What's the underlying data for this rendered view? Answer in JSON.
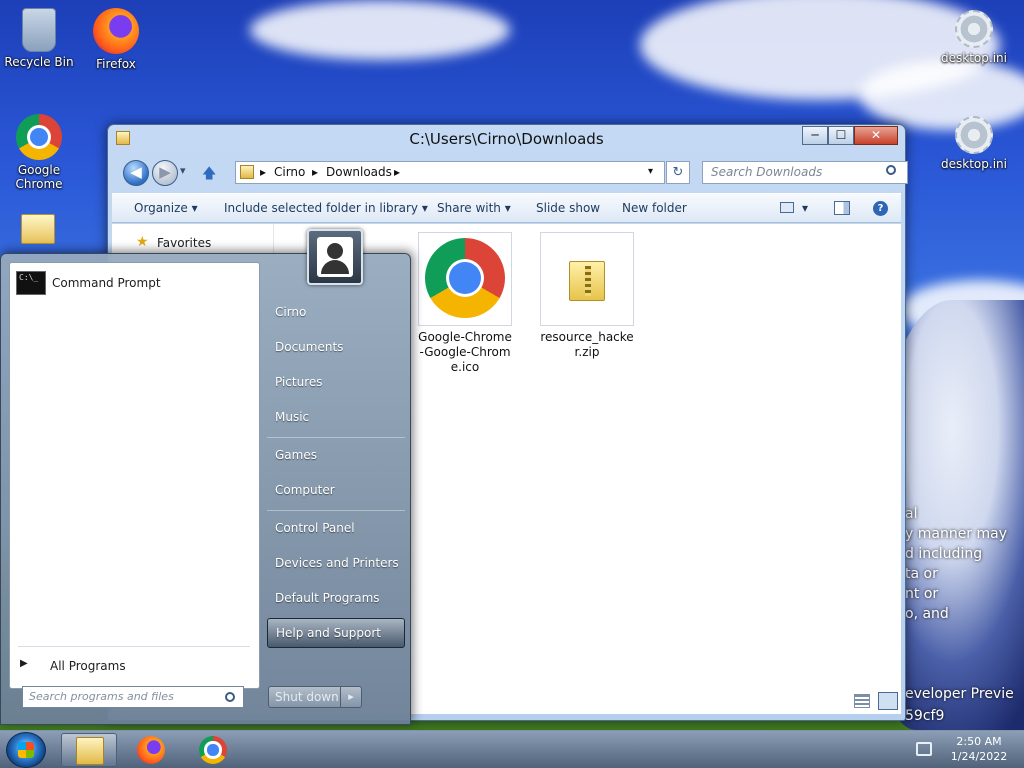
{
  "desktop": {
    "icons": [
      {
        "label": "Recycle Bin",
        "icon": "recycle-bin-icon"
      },
      {
        "label": "Firefox",
        "icon": "firefox-icon"
      },
      {
        "label": "Google Chrome",
        "icon": "chrome-icon"
      },
      {
        "label": "desktop.ini",
        "icon": "settings-file-icon"
      },
      {
        "label": "desktop.ini",
        "icon": "settings-file-icon"
      }
    ],
    "wallpaper_text": [
      "al",
      "y manner may",
      "d including",
      "ta or",
      "nt or",
      "o, and",
      "eveloper Previe",
      "59cf9"
    ]
  },
  "explorer": {
    "title": "C:\\Users\\Cirno\\Downloads",
    "window_controls": {
      "minimize": "─",
      "maximize": "☐",
      "close": "✕"
    },
    "nav": {
      "back": "◀",
      "forward": "▶",
      "recent": "▾",
      "up": "🡅",
      "refresh": "↻",
      "dropdown": "▾"
    },
    "address": {
      "crumbs": [
        "Cirno",
        "Downloads"
      ],
      "separator": "▸"
    },
    "search_placeholder": "Search Downloads",
    "commands": [
      {
        "label": "Organize",
        "arrow": "▾"
      },
      {
        "label": "Include selected folder in library",
        "arrow": "▾"
      },
      {
        "label": "Share with",
        "arrow": "▾"
      },
      {
        "label": "Slide show",
        "arrow": ""
      },
      {
        "label": "New folder",
        "arrow": ""
      }
    ],
    "navpane": {
      "favorites": "Favorites"
    },
    "files": [
      {
        "name": "Google-Chrome-Google-Chrome.ico",
        "icon": "chrome-icon"
      },
      {
        "name": "resource_hacker.zip",
        "icon": "zip-folder-icon"
      }
    ]
  },
  "start_menu": {
    "pinned": [
      {
        "label": "Command Prompt",
        "icon": "command-prompt-icon"
      }
    ],
    "all_programs": "All Programs",
    "all_programs_arrow": "▶",
    "search_placeholder": "Search programs and files",
    "right_items": [
      "Cirno",
      "Documents",
      "Pictures",
      "Music",
      "Games",
      "Computer",
      "Control Panel",
      "Devices and Printers",
      "Default Programs",
      "Help and Support"
    ],
    "highlighted_item": "Help and Support",
    "shutdown": "Shut down",
    "shutdown_arrow": "▸"
  },
  "taskbar": {
    "items": [
      {
        "name": "Windows Explorer",
        "icon": "folder-icon",
        "active": true
      },
      {
        "name": "Firefox",
        "icon": "firefox-icon",
        "active": false
      },
      {
        "name": "Google Chrome",
        "icon": "chrome-icon",
        "active": false
      }
    ],
    "time": "2:50 AM",
    "date": "1/24/2022"
  },
  "colors": {
    "accent": "#2d6fc6",
    "window_frame": "#b7cfee",
    "taskbar": "#465a73"
  }
}
